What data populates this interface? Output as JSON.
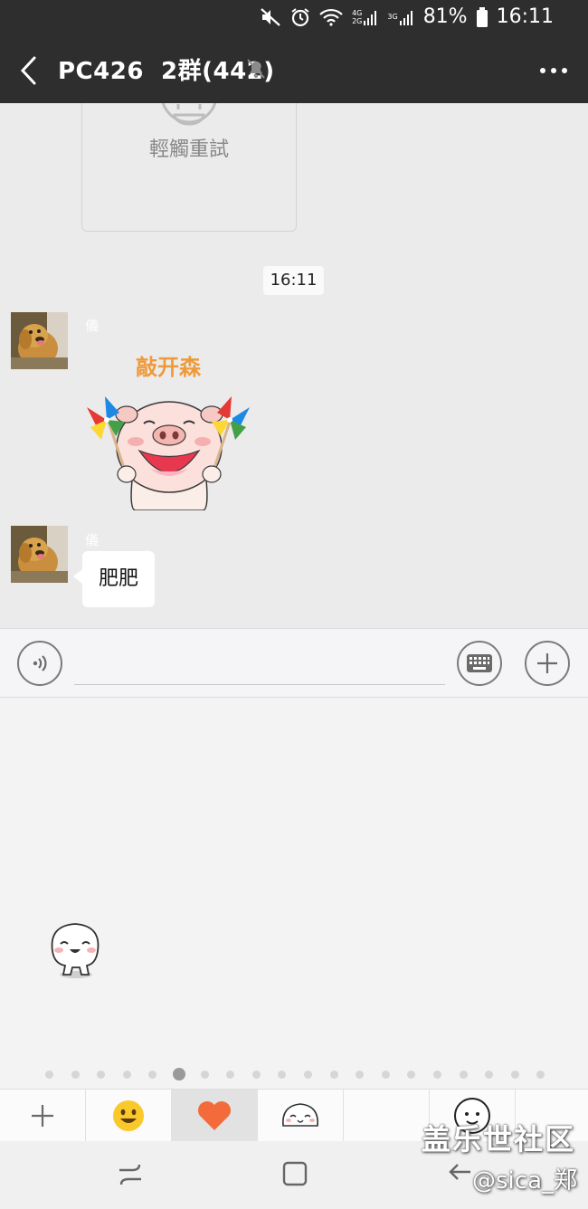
{
  "status_bar": {
    "network_labels": [
      "4G",
      "2G",
      "3G"
    ],
    "battery": "81%",
    "time": "16:11"
  },
  "title_bar": {
    "title": "PC426  2群(442)",
    "icons": [
      "back-arrow-icon",
      "mute-bell-icon",
      "more-dots-icon"
    ]
  },
  "chat": {
    "retry_card": {
      "label": "輕觸重試"
    },
    "timestamp": "16:11",
    "messages": [
      {
        "sender": "儀",
        "type": "sticker",
        "sticker_caption": "敲开森"
      },
      {
        "sender": "儀",
        "type": "text",
        "text": "肥肥"
      }
    ]
  },
  "input_bar": {
    "value": "",
    "icons": [
      "voice-icon",
      "keyboard-icon",
      "plus-icon"
    ]
  },
  "emoji_panel": {
    "page_count": 20,
    "active_page": 6,
    "tabs": [
      "add-icon",
      "smiley-emoji-icon",
      "heart-icon",
      "mochi-sticker-icon",
      "blank",
      "smiley-sticker-icon"
    ],
    "selected_tab": 2
  },
  "watermark": {
    "main": "盖乐世社区",
    "sub": "@sica_郑"
  },
  "colors": {
    "title_bar": "#2e2e2e",
    "chat_bg": "#ebebeb",
    "heart": "#f36b3a",
    "sticker_caption": "#ee9a3a"
  }
}
